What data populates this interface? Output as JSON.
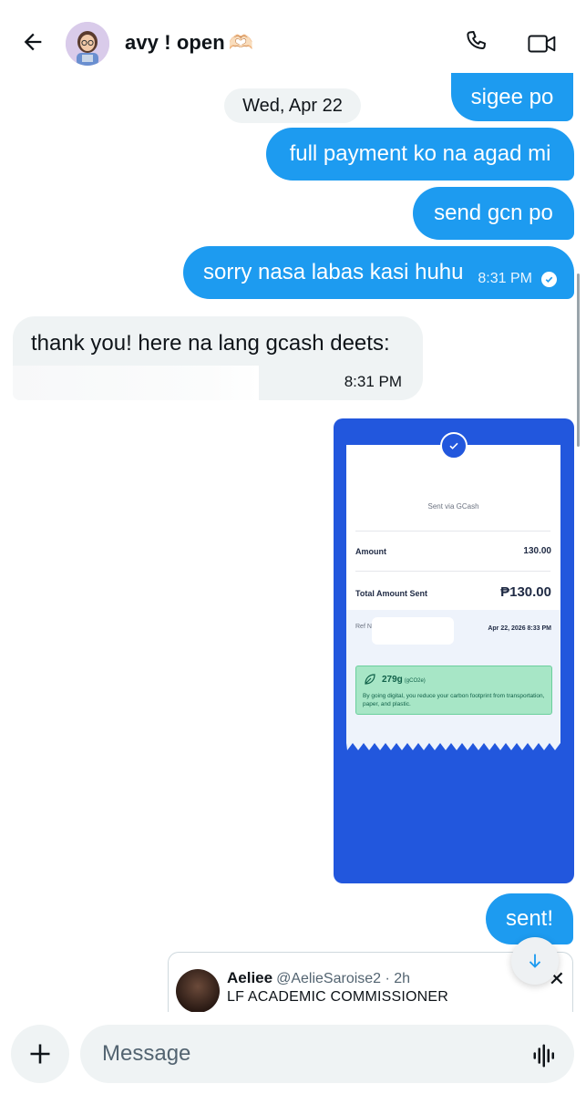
{
  "header": {
    "title": "avy ! open",
    "title_emoji": "🫶🏻"
  },
  "messages": {
    "date_divider": "Wed, Apr 22",
    "m1": "sigee po",
    "m2": "full payment ko na agad mi",
    "m3": "send gcn po",
    "m4": {
      "text": "sorry nasa labas kasi huhu",
      "time": "8:31 PM"
    },
    "m5": {
      "text": "thank you! here na lang gcash deets:",
      "time": "8:31 PM"
    },
    "m6": "sent!"
  },
  "receipt": {
    "sent_via": "Sent via GCash",
    "amount_label": "Amount",
    "amount_value": "130.00",
    "total_label": "Total Amount Sent",
    "total_value": "₱130.00",
    "ref_label": "Ref N",
    "date": "Apr 22, 2026 8:33 PM",
    "carbon_value": "279g",
    "carbon_unit": "(gCO2e)",
    "carbon_text": "By going digital, you reduce your carbon footprint from transportation, paper, and plastic."
  },
  "tweet": {
    "name": "Aeliee",
    "handle": "@AelieSaroise2 · 2h",
    "text": "LF ACADEMIC COMMISSIONER"
  },
  "composer": {
    "placeholder": "Message"
  },
  "colors": {
    "accent": "#1d9bf0",
    "receipt_blue": "#2257dd",
    "incoming_bg": "#eff3f4"
  },
  "icons": [
    "back-arrow-icon",
    "phone-icon",
    "video-camera-icon",
    "checkmark-circle-icon",
    "chevron-down-icon",
    "close-icon",
    "plus-icon",
    "voice-waveform-icon"
  ]
}
